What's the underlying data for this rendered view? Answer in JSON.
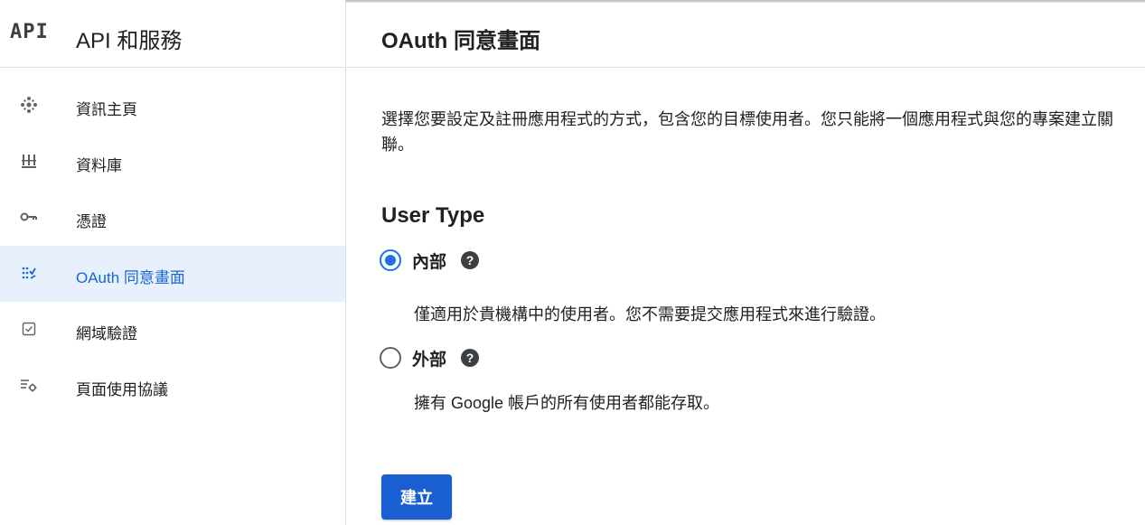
{
  "brand": {
    "logo": "API",
    "title": "API 和服務"
  },
  "nav": {
    "items": [
      {
        "label": "資訊主頁",
        "icon": "dashboard-icon"
      },
      {
        "label": "資料庫",
        "icon": "library-icon"
      },
      {
        "label": "憑證",
        "icon": "key-icon"
      },
      {
        "label": "OAuth 同意畫面",
        "icon": "oauth-consent-icon",
        "active": true
      },
      {
        "label": "網域驗證",
        "icon": "checkbox-icon"
      },
      {
        "label": "頁面使用協議",
        "icon": "settings-list-icon"
      }
    ]
  },
  "main": {
    "title": "OAuth 同意畫面",
    "description": "選擇您要設定及註冊應用程式的方式，包含您的目標使用者。您只能將一個應用程式與您的專案建立關聯。",
    "user_type_title": "User Type",
    "options": [
      {
        "label": "內部",
        "help": "?",
        "description": "僅適用於貴機構中的使用者。您不需要提交應用程式來進行驗證。",
        "checked": true
      },
      {
        "label": "外部",
        "help": "?",
        "description": "擁有 Google 帳戶的所有使用者都能存取。",
        "checked": false
      }
    ],
    "create_label": "建立"
  },
  "colors": {
    "accent": "#1a73e8",
    "button": "#1a5fd1",
    "active_bg": "#e8f0fe"
  }
}
